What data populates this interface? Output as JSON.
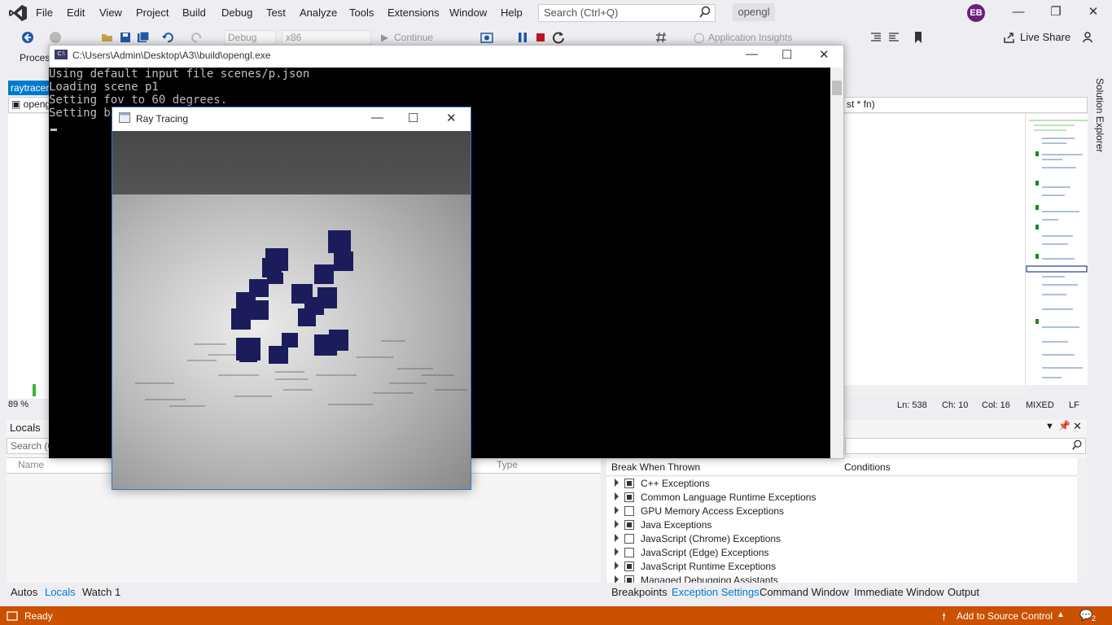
{
  "menu": {
    "items": [
      "File",
      "Edit",
      "View",
      "Project",
      "Build",
      "Debug",
      "Test",
      "Analyze",
      "Tools",
      "Extensions",
      "Window",
      "Help"
    ],
    "search_placeholder": "Search (Ctrl+Q)",
    "solution_name": "opengl",
    "user_initials": "EB"
  },
  "toolbar": {
    "config": "Debug",
    "platform": "x86",
    "continue_label": "Continue",
    "app_insights": "Application Insights",
    "live_share": "Live Share",
    "process_label": "Proces"
  },
  "editor": {
    "tab_label": "raytracer",
    "nav_left": "openg",
    "nav_right": "st * fn)",
    "zoom": "89 %",
    "line": "Ln: 538",
    "char": "Ch: 10",
    "col": "Col: 16",
    "line_endings_mode": "MIXED",
    "line_ending": "LF",
    "solution_explorer": "Solution Explorer"
  },
  "console": {
    "title": "C:\\Users\\Admin\\Desktop\\A3\\\\build\\opengl.exe",
    "lines": [
      "Using default input file scenes/p.json",
      "Loading scene p1",
      "Setting fov to 60 degrees.",
      "Setting ba"
    ]
  },
  "ray_window": {
    "title": "Ray Tracing"
  },
  "locals": {
    "title": "Locals",
    "search_placeholder": "Search (C",
    "col_name": "Name",
    "col_type": "Type",
    "tabs": [
      "Autos",
      "Locals",
      "Watch 1"
    ]
  },
  "exceptions": {
    "col_break": "Break When Thrown",
    "col_conditions": "Conditions",
    "rows": [
      {
        "label": "C++ Exceptions",
        "checked": true
      },
      {
        "label": "Common Language Runtime Exceptions",
        "checked": true
      },
      {
        "label": "GPU Memory Access Exceptions",
        "checked": false
      },
      {
        "label": "Java Exceptions",
        "checked": true
      },
      {
        "label": "JavaScript (Chrome) Exceptions",
        "checked": false
      },
      {
        "label": "JavaScript (Edge) Exceptions",
        "checked": false
      },
      {
        "label": "JavaScript Runtime Exceptions",
        "checked": true
      },
      {
        "label": "Managed Debugging Assistants",
        "checked": true
      }
    ],
    "tabs": [
      "Breakpoints",
      "Exception Settings",
      "Command Window",
      "Immediate Window",
      "Output"
    ]
  },
  "status": {
    "ready": "Ready",
    "source_control": "Add to Source Control",
    "notifications": "2"
  },
  "colors": {
    "accent": "#007acc",
    "statusbar": "#ca5100",
    "cube": "#1c1c5c"
  }
}
